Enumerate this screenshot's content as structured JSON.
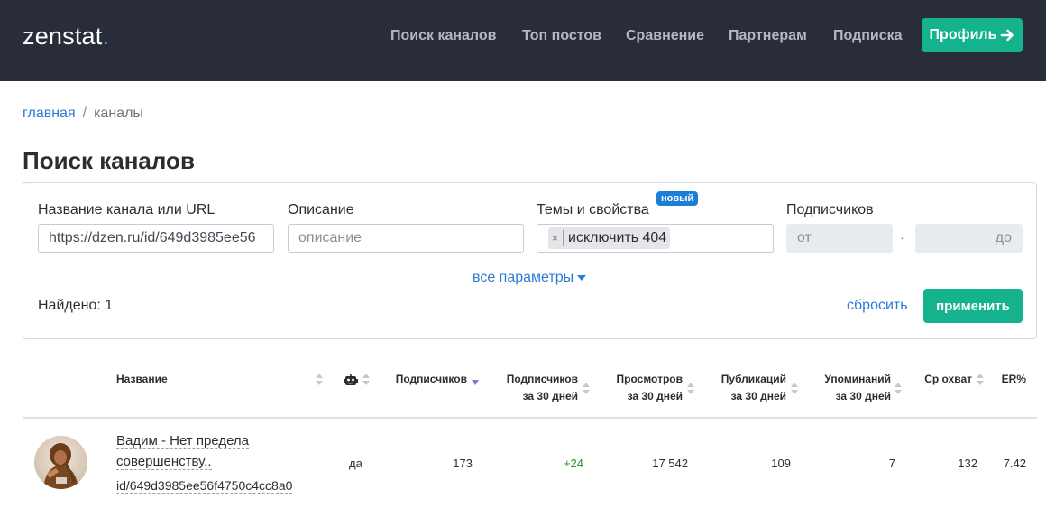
{
  "header": {
    "logo_text": "zenstat",
    "logo_dot": ".",
    "nav": [
      "Поиск каналов",
      "Топ постов",
      "Сравнение",
      "Партнерам",
      "Подписка"
    ],
    "profile_label": "Профиль",
    "accent_color": "#14b38d",
    "bg_color": "#292d3a"
  },
  "breadcrumb": {
    "home": "главная",
    "separator": "/",
    "current": "каналы"
  },
  "page_title": "Поиск каналов",
  "filters": {
    "name_label": "Название канала или URL",
    "name_value": "https://dzen.ru/id/649d3985ee56",
    "description_label": "Описание",
    "description_placeholder": "описание",
    "topics_label": "Темы и свойства",
    "topics_badge": "новый",
    "topics_chip": "исключить 404",
    "topics_chip_remove": "×",
    "subscribers_label": "Подписчиков",
    "from_placeholder": "от",
    "to_placeholder": "до",
    "range_separator": "·",
    "all_params": "все параметры",
    "found": "Найдено: 1",
    "reset": "сбросить",
    "apply": "применить"
  },
  "table": {
    "headers": {
      "name": "Название",
      "subscribers": "Подписчиков",
      "subs30_l1": "Подписчиков",
      "subs30_l2": "за 30 дней",
      "views_l1": "Просмотров",
      "views_l2": "за 30 дней",
      "pubs_l1": "Публикаций",
      "pubs_l2": "за 30 дней",
      "mentions_l1": "Упоминаний",
      "mentions_l2": "за 30 дней",
      "reach": "Ср охват",
      "er": "ER%"
    },
    "rows": [
      {
        "name_l1": "Вадим - Нет предела",
        "name_l2": "совершенству..",
        "id": "id/649d3985ee56f4750c4cc8a0",
        "bot": "да",
        "subscribers": "173",
        "subs30": "+24",
        "views30": "17 542",
        "pubs30": "109",
        "mentions30": "7",
        "reach": "132",
        "er": "7.42"
      }
    ]
  }
}
